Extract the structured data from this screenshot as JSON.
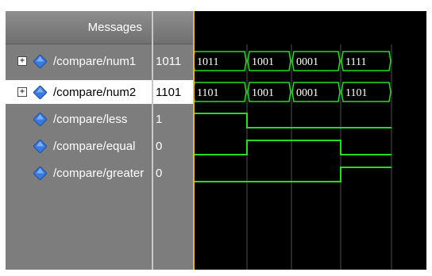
{
  "header": {
    "messages_label": "Messages"
  },
  "signals": [
    {
      "name": "/compare/num1",
      "value": "1011",
      "expandable": true,
      "selected": false,
      "type": "bus",
      "segments": [
        "1011",
        "1001",
        "0001",
        "1111"
      ]
    },
    {
      "name": "/compare/num2",
      "value": "1101",
      "expandable": true,
      "selected": true,
      "type": "bus",
      "segments": [
        "1101",
        "1001",
        "0001",
        "1101"
      ]
    },
    {
      "name": "/compare/less",
      "value": "1",
      "expandable": false,
      "selected": false,
      "type": "bit",
      "levels": [
        1,
        0,
        0,
        0
      ]
    },
    {
      "name": "/compare/equal",
      "value": "0",
      "expandable": false,
      "selected": false,
      "type": "bit",
      "levels": [
        0,
        1,
        1,
        0
      ]
    },
    {
      "name": "/compare/greater",
      "value": "0",
      "expandable": false,
      "selected": false,
      "type": "bit",
      "levels": [
        0,
        0,
        0,
        1
      ]
    }
  ],
  "colors": {
    "wave": "#22dd22",
    "bus_outline": "#22dd22",
    "grid": "#505050",
    "cursor": "#e8c000",
    "diamond": "#3a7be0",
    "pane_bg": "#7d7d7d"
  },
  "icons": {
    "signal": "diamond-signal-icon",
    "expand": "expand-plus-icon"
  }
}
